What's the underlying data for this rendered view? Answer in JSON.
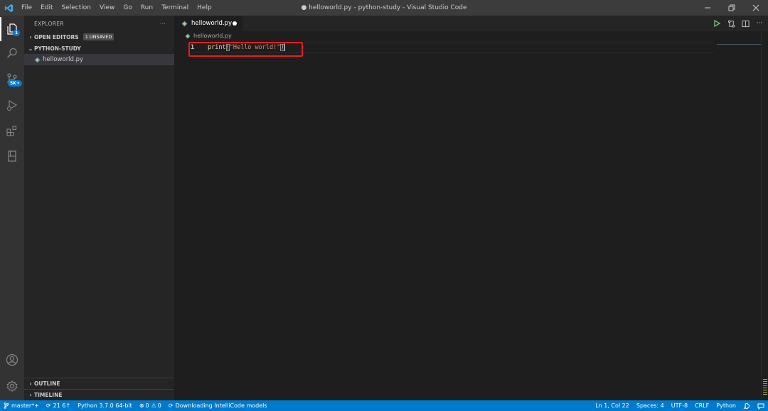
{
  "titlebar": {
    "menu": [
      "File",
      "Edit",
      "Selection",
      "View",
      "Go",
      "Run",
      "Terminal",
      "Help"
    ],
    "window_title": "● helloworld.py - python-study - Visual Studio Code"
  },
  "activitybar": {
    "explorer_badge": "1",
    "source_control_badge": "5K+"
  },
  "sidebar": {
    "title": "EXPLORER",
    "more": "···",
    "open_editors": "OPEN EDITORS",
    "unsaved_badge": "1 UNSAVED",
    "folder": "PYTHON-STUDY",
    "files": [
      "helloworld.py"
    ],
    "outline": "OUTLINE",
    "timeline": "TIMELINE"
  },
  "editor": {
    "tab_label": "helloworld.py",
    "breadcrumb": "helloworld.py",
    "line_number": "1",
    "code_fn": "print",
    "code_open": "(",
    "code_str": "\"Hello world!\"",
    "code_close": ")"
  },
  "statusbar": {
    "branch": "master*+",
    "sync": "21 6↑",
    "interpreter": "Python 3.7.0 64-bit",
    "errors": "0",
    "warnings": "0",
    "task": "Downloading IntelliCode models",
    "position": "Ln 1, Col 22",
    "spaces": "Spaces: 4",
    "encoding": "UTF-8",
    "eol": "CRLF",
    "language": "Python"
  },
  "colors": {
    "accent": "#007acc",
    "highlight_box": "#e51c1c"
  }
}
